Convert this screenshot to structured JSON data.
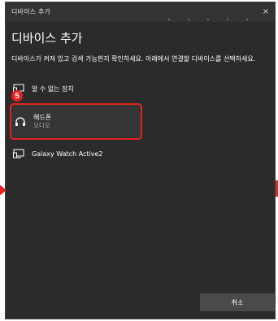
{
  "window": {
    "title": "디바이스 추가",
    "close_label": "×"
  },
  "heading": "디바이스 추가",
  "description": "디바이스가 켜져 있고 검색 가능한지 확인하세요. 아래에서 연결할 디바이스를 선택하세요.",
  "devices": [
    {
      "name": "알 수 없는 장치",
      "subtitle": "",
      "icon": "monitor-icon"
    },
    {
      "name": "헤드폰",
      "subtitle": "오디오",
      "icon": "headphones-icon",
      "highlighted": true
    },
    {
      "name": "Galaxy Watch Active2",
      "subtitle": "",
      "icon": "monitor-icon"
    }
  ],
  "annotation": {
    "step_number": "5",
    "highlight_color": "#e32020"
  },
  "buttons": {
    "cancel_label": "취소"
  },
  "colors": {
    "background": "#2b2b2b",
    "accent": "#4a90e2",
    "button": "#4a4a4a"
  }
}
